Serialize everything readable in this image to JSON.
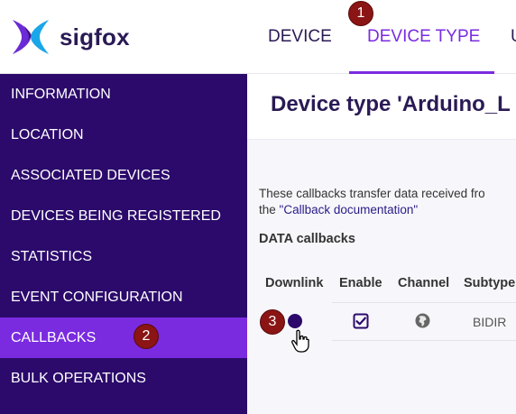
{
  "header": {
    "brand": "sigfox",
    "nav": [
      {
        "label": "DEVICE"
      },
      {
        "label": "DEVICE TYPE"
      },
      {
        "label": "U"
      }
    ],
    "active_color": "#7a2be0"
  },
  "markers": [
    "1",
    "2",
    "3"
  ],
  "sidebar": {
    "background": "#2b0a6b",
    "items": [
      {
        "label": "INFORMATION"
      },
      {
        "label": "LOCATION"
      },
      {
        "label": "ASSOCIATED DEVICES"
      },
      {
        "label": "DEVICES BEING REGISTERED"
      },
      {
        "label": "STATISTICS"
      },
      {
        "label": "EVENT CONFIGURATION"
      },
      {
        "label": "CALLBACKS"
      },
      {
        "label": "BULK OPERATIONS"
      }
    ],
    "active_index": 6
  },
  "main": {
    "title": "Device type 'Arduino_L",
    "description_line1": "These callbacks transfer data received fro",
    "description_line2_prefix": "the ",
    "description_link": "\"Callback documentation\"",
    "section_title": "DATA callbacks",
    "table": {
      "headers": [
        "Downlink",
        "Enable",
        "Channel",
        "Subtype"
      ],
      "rows": [
        {
          "downlink": "selected",
          "enable": "checked",
          "channel": "globe-icon",
          "subtype": "BIDIR"
        }
      ]
    }
  }
}
